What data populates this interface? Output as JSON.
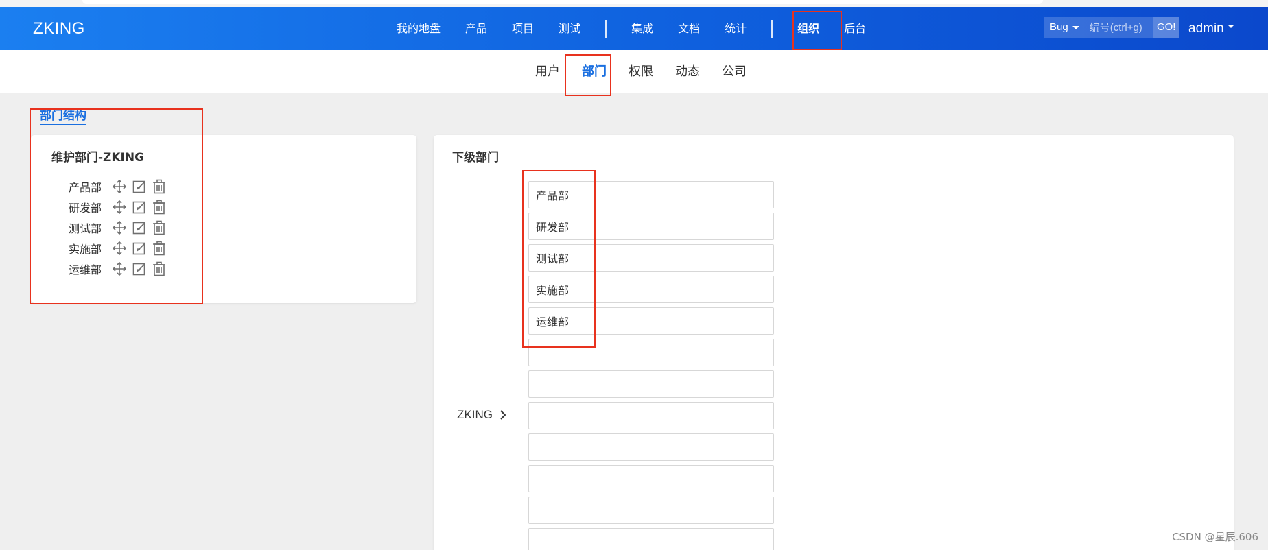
{
  "app": {
    "logo": "ZKING"
  },
  "nav": {
    "items": [
      "我的地盘",
      "产品",
      "项目",
      "测试",
      "集成",
      "文档",
      "统计",
      "组织",
      "后台"
    ],
    "active": "组织"
  },
  "search": {
    "type": "Bug",
    "placeholder": "编号(ctrl+g)",
    "go": "GO!"
  },
  "user": {
    "name": "admin"
  },
  "subnav": {
    "tabs": [
      "用户",
      "部门",
      "权限",
      "动态",
      "公司"
    ],
    "active": "部门"
  },
  "page": {
    "section_title": "部门结构"
  },
  "left_panel": {
    "title": "维护部门-ZKING",
    "departments": [
      "产品部",
      "研发部",
      "测试部",
      "实施部",
      "运维部"
    ]
  },
  "right_panel": {
    "title": "下级部门",
    "root": "ZKING",
    "children": [
      "产品部",
      "研发部",
      "测试部",
      "实施部",
      "运维部",
      "",
      "",
      "",
      "",
      "",
      "",
      ""
    ]
  },
  "watermark": "CSDN @星辰.606",
  "colors": {
    "nav_start": "#1b7ff0",
    "nav_end": "#0b48cc",
    "accent": "#1a6fe0",
    "highlight": "#e8321e"
  }
}
